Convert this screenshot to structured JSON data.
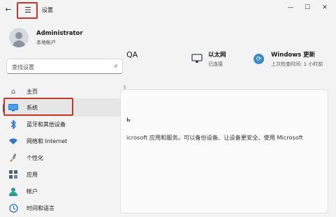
{
  "window": {
    "title": "设置"
  },
  "title_bar": {
    "back_glyph": "←",
    "menu_glyph": "☰",
    "minimize_glyph": "—",
    "maximize_glyph": "☐",
    "close_glyph": "✕"
  },
  "account": {
    "name": "Administrator",
    "type": "本地帐户"
  },
  "search": {
    "placeholder": "查找设置"
  },
  "sidebar": {
    "items": [
      {
        "label": "主页",
        "icon": "home-icon",
        "glyph": "⌂",
        "color": "#555555"
      },
      {
        "label": "系统",
        "icon": "display-icon",
        "glyph": "",
        "color": "#2f7fd6",
        "selected": true
      },
      {
        "label": "蓝牙和其他设备",
        "icon": "bluetooth-icon",
        "glyph": "ʙ",
        "color": "#1a6fd0"
      },
      {
        "label": "网络和 Internet",
        "icon": "wifi-icon",
        "glyph": "◆",
        "color": "#2e74c7"
      },
      {
        "label": "个性化",
        "icon": "brush-icon",
        "glyph": "✎",
        "color": "#c7792b"
      },
      {
        "label": "应用",
        "icon": "apps-icon",
        "glyph": "▦",
        "color": "#555e6c"
      },
      {
        "label": "帐户",
        "icon": "account-icon",
        "glyph": "●",
        "color": "#2a9d8f"
      },
      {
        "label": "时间和语言",
        "icon": "globe-clock-icon",
        "glyph": "◷",
        "color": "#2e74c7"
      }
    ]
  },
  "main": {
    "device_name_fragment": "QA",
    "ethernet": {
      "label": "以太网",
      "status": "已连接"
    },
    "windows_update": {
      "label": "Windows 更新",
      "status": "上次检查时间: 1 小时前",
      "glyph": "⟳"
    },
    "card": {
      "fragment": "ь",
      "text": "icrosoft 应用和服务。可以备份设备、让设备更安全、使用 Microsoft"
    }
  },
  "colors": {
    "accent": "#0067c0",
    "highlight_box": "#c0392b"
  }
}
